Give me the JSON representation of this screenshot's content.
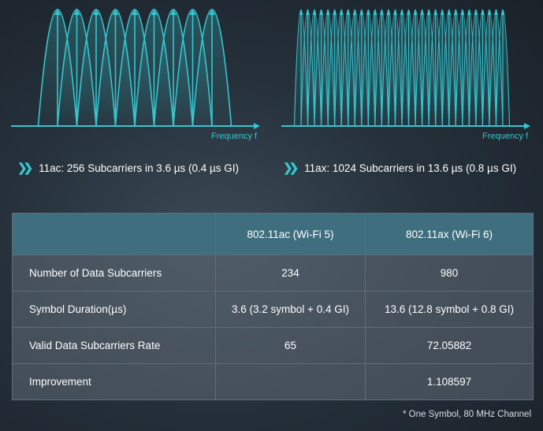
{
  "colors": {
    "accent": "#37c6cf",
    "table_header": "#3f6e7e"
  },
  "diagrams": [
    {
      "axis_label": "Frequency f",
      "caption": "11ac: 256 Subcarriers in 3.6 µs (0.4 µs GI)",
      "subcarrier_count": 9
    },
    {
      "axis_label": "Frequency f",
      "caption": "11ax: 1024 Subcarriers in 13.6 µs (0.8 µs GI)",
      "subcarrier_count": 31
    }
  ],
  "table": {
    "headers": [
      "",
      "802.11ac (Wi-Fi 5)",
      "802.11ax (Wi-Fi 6)"
    ],
    "rows": [
      [
        "Number of Data Subcarriers",
        "234",
        "980"
      ],
      [
        "Symbol Duration(µs)",
        "3.6 (3.2 symbol + 0.4 GI)",
        "13.6 (12.8 symbol + 0.8 GI)"
      ],
      [
        "Valid Data Subcarriers Rate",
        "65",
        "72.05882"
      ],
      [
        "Improvement",
        "",
        "1.108597"
      ]
    ]
  },
  "footnote": "* One Symbol, 80 MHz Channel"
}
